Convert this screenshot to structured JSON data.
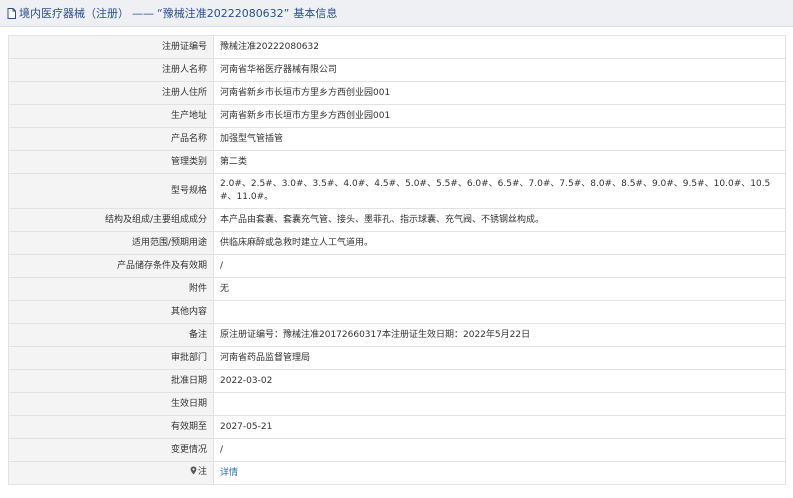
{
  "header": {
    "breadcrumb_prefix": "境内医疗器械（注册）",
    "separator": "——",
    "record_title": "“豫械注准20222080632”",
    "suffix": "基本信息",
    "icon": "document-icon"
  },
  "rows": [
    {
      "label": "注册证编号",
      "value": "豫械注准20222080632"
    },
    {
      "label": "注册人名称",
      "value": "河南省华裕医疗器械有限公司"
    },
    {
      "label": "注册人住所",
      "value": "河南省新乡市长垣市方里乡方西创业园001"
    },
    {
      "label": "生产地址",
      "value": "河南省新乡市长垣市方里乡方西创业园001"
    },
    {
      "label": "产品名称",
      "value": "加强型气管插管"
    },
    {
      "label": "管理类别",
      "value": "第二类"
    },
    {
      "label": "型号规格",
      "value": "2.0#、2.5#、3.0#、3.5#、4.0#、4.5#、5.0#、5.5#、6.0#、6.5#、7.0#、7.5#、8.0#、8.5#、9.0#、9.5#、10.0#、10.5#、11.0#。"
    },
    {
      "label": "结构及组成/主要组成成分",
      "value": "本产品由套囊、套囊充气管、接头、墨菲孔、指示球囊、充气阀、不锈钢丝构成。"
    },
    {
      "label": "适用范围/预期用途",
      "value": "供临床麻醉或急救时建立人工气道用。"
    },
    {
      "label": "产品储存条件及有效期",
      "value": "/"
    },
    {
      "label": "附件",
      "value": "无"
    },
    {
      "label": "其他内容",
      "value": ""
    },
    {
      "label": "备注",
      "value": "原注册证编号：豫械注准20172660317本注册证生效日期：2022年5月22日"
    },
    {
      "label": "审批部门",
      "value": "河南省药品监督管理局"
    },
    {
      "label": "批准日期",
      "value": "2022-03-02"
    },
    {
      "label": "生效日期",
      "value": ""
    },
    {
      "label": "有效期至",
      "value": "2027-05-21"
    },
    {
      "label": "变更情况",
      "value": "/"
    }
  ],
  "note_row": {
    "label": "注",
    "icon": "location-pin-icon",
    "link": "详情"
  },
  "colors": {
    "header_bg": "#eef0f4",
    "title": "#2a4f8f",
    "label_bg": "#f4f4f4",
    "border": "#e2e2e2",
    "link": "#2a6cb8"
  }
}
